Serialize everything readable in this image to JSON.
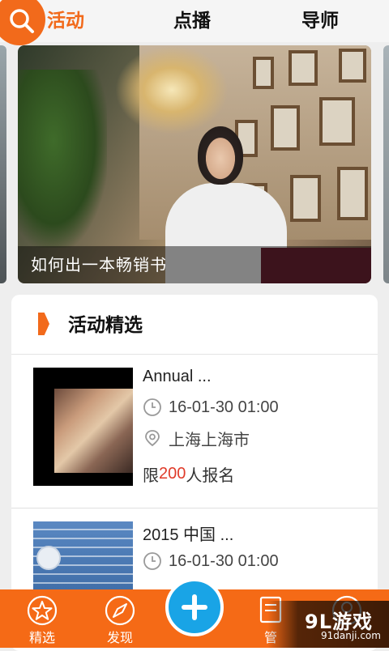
{
  "header": {
    "tabs": [
      {
        "label": "活动",
        "active": true
      },
      {
        "label": "点播",
        "active": false
      },
      {
        "label": "导师",
        "active": false
      }
    ],
    "search_icon": "search-icon"
  },
  "banner": {
    "caption": "如何出一本畅销书"
  },
  "section": {
    "title": "活动精选"
  },
  "events": [
    {
      "title": "Annual ...",
      "time": "16-01-30 01:00",
      "location": "上海上海市",
      "quota_prefix": "限",
      "quota_number": "200",
      "quota_suffix": "人报名"
    },
    {
      "title": "2015 中国 ...",
      "time": "16-01-30 01:00"
    }
  ],
  "bottom_nav": {
    "items": [
      {
        "label": "精选",
        "icon": "star-icon"
      },
      {
        "label": "发现",
        "icon": "compass-icon"
      },
      {
        "label": "管",
        "icon": "manage-icon"
      }
    ],
    "fab_icon": "plus-icon"
  },
  "watermark": {
    "logo": "9L游戏",
    "url": "91danji.com"
  },
  "colors": {
    "accent": "#f26a1b",
    "fab": "#19a4e6",
    "quota": "#e03b2a"
  }
}
